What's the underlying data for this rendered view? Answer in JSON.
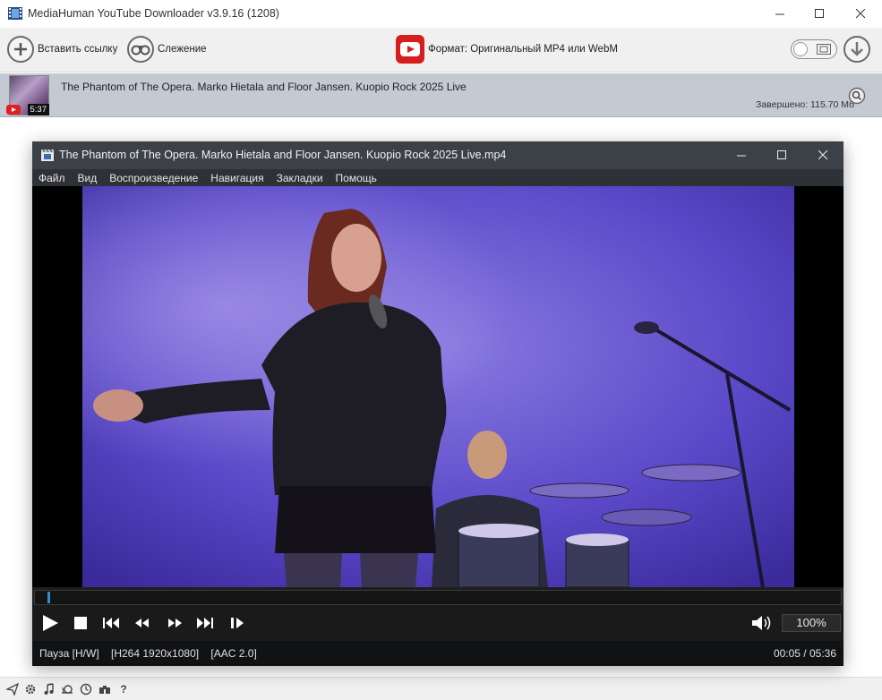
{
  "app": {
    "title": "MediaHuman YouTube Downloader v3.9.16 (1208)"
  },
  "toolbar": {
    "paste_label": "Вставить ссылку",
    "track_label": "Слежение",
    "format_label": "Формат: Оригинальный MP4 или WebM"
  },
  "download": {
    "title": "The Phantom of The Opera. Marko Hietala and Floor Jansen. Kuopio Rock 2025 Live",
    "duration": "5:37",
    "status": "Завершено: 115.70 Мб"
  },
  "player": {
    "title": "The Phantom of The Opera. Marko Hietala and Floor Jansen. Kuopio Rock 2025 Live.mp4",
    "menu": [
      "Файл",
      "Вид",
      "Воспроизведение",
      "Навигация",
      "Закладки",
      "Помощь"
    ],
    "zoom": "100%",
    "status_left": "Пауза [H/W]    [H264 1920x1080]    [AAC 2.0]",
    "status_time": "00:05 / 05:36",
    "progress_fraction": 0.015
  },
  "colors": {
    "accent_blue": "#2e8fd4",
    "youtube_red": "#d71e1e",
    "row_bg": "#c3cad4",
    "player_title_bg": "#3c4047"
  },
  "statusbar_icons": [
    "send-icon",
    "gear-icon",
    "music-icon",
    "snail-icon",
    "clock-icon",
    "binoculars-icon",
    "help-icon"
  ]
}
